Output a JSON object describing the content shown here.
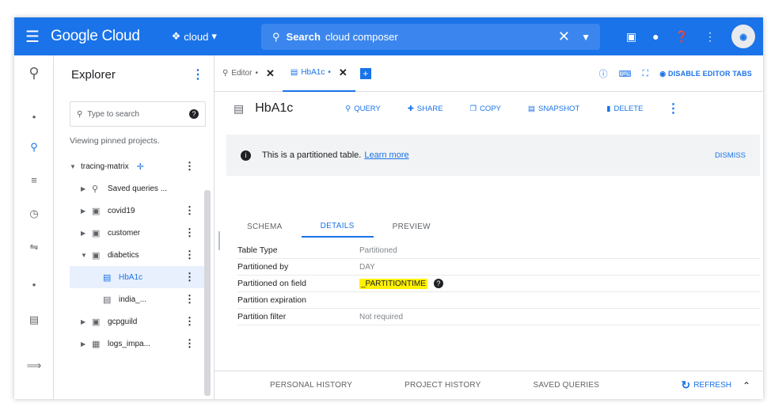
{
  "topbar": {
    "brand": "Google Cloud",
    "project": "cloud",
    "search_label": "Search",
    "search_value": "cloud composer",
    "colors": {
      "bar": "#1a73e8"
    }
  },
  "rail": {
    "items": [
      "product-icon",
      "pin-icon",
      "search-icon",
      "list-icon",
      "history-icon",
      "transfer-icon",
      "dot-icon",
      "schedule-icon",
      "expand-icon"
    ]
  },
  "explorer": {
    "title": "Explorer",
    "search_placeholder": "Type to search",
    "pinned_note": "Viewing pinned projects.",
    "tree": [
      {
        "label": "tracing-matrix",
        "level": 0,
        "expanded": true
      },
      {
        "label": "Saved queries ...",
        "level": 1
      },
      {
        "label": "covid19",
        "level": 1
      },
      {
        "label": "customer",
        "level": 1
      },
      {
        "label": "diabetics",
        "level": 1,
        "expanded": true
      },
      {
        "label": "HbA1c",
        "level": 2,
        "selected": true
      },
      {
        "label": "india_...",
        "level": 2
      },
      {
        "label": "gcpguild",
        "level": 1
      },
      {
        "label": "logs_impa...",
        "level": 1
      }
    ]
  },
  "tabs": {
    "editor": "Editor",
    "table": "HbA1c",
    "disable_editor_tabs": "DISABLE EDITOR TABS"
  },
  "table_header": {
    "name": "HbA1c",
    "actions": [
      "QUERY",
      "SHARE",
      "COPY",
      "SNAPSHOT",
      "DELETE"
    ]
  },
  "notice": {
    "text": "This is a partitioned table.",
    "link": "Learn more",
    "dismiss": "DISMISS"
  },
  "subtabs": [
    "SCHEMA",
    "DETAILS",
    "PREVIEW"
  ],
  "details": [
    {
      "key": "Table Type",
      "value": "Partitioned"
    },
    {
      "key": "Partitioned by",
      "value": "DAY"
    },
    {
      "key": "Partitioned on field",
      "value": "_PARTITIONTIME"
    },
    {
      "key": "Partition expiration",
      "value": ""
    },
    {
      "key": "Partition filter",
      "value": "Not required"
    }
  ],
  "bottom": {
    "tabs": [
      "PERSONAL HISTORY",
      "PROJECT HISTORY",
      "SAVED QUERIES"
    ],
    "refresh": "REFRESH"
  }
}
